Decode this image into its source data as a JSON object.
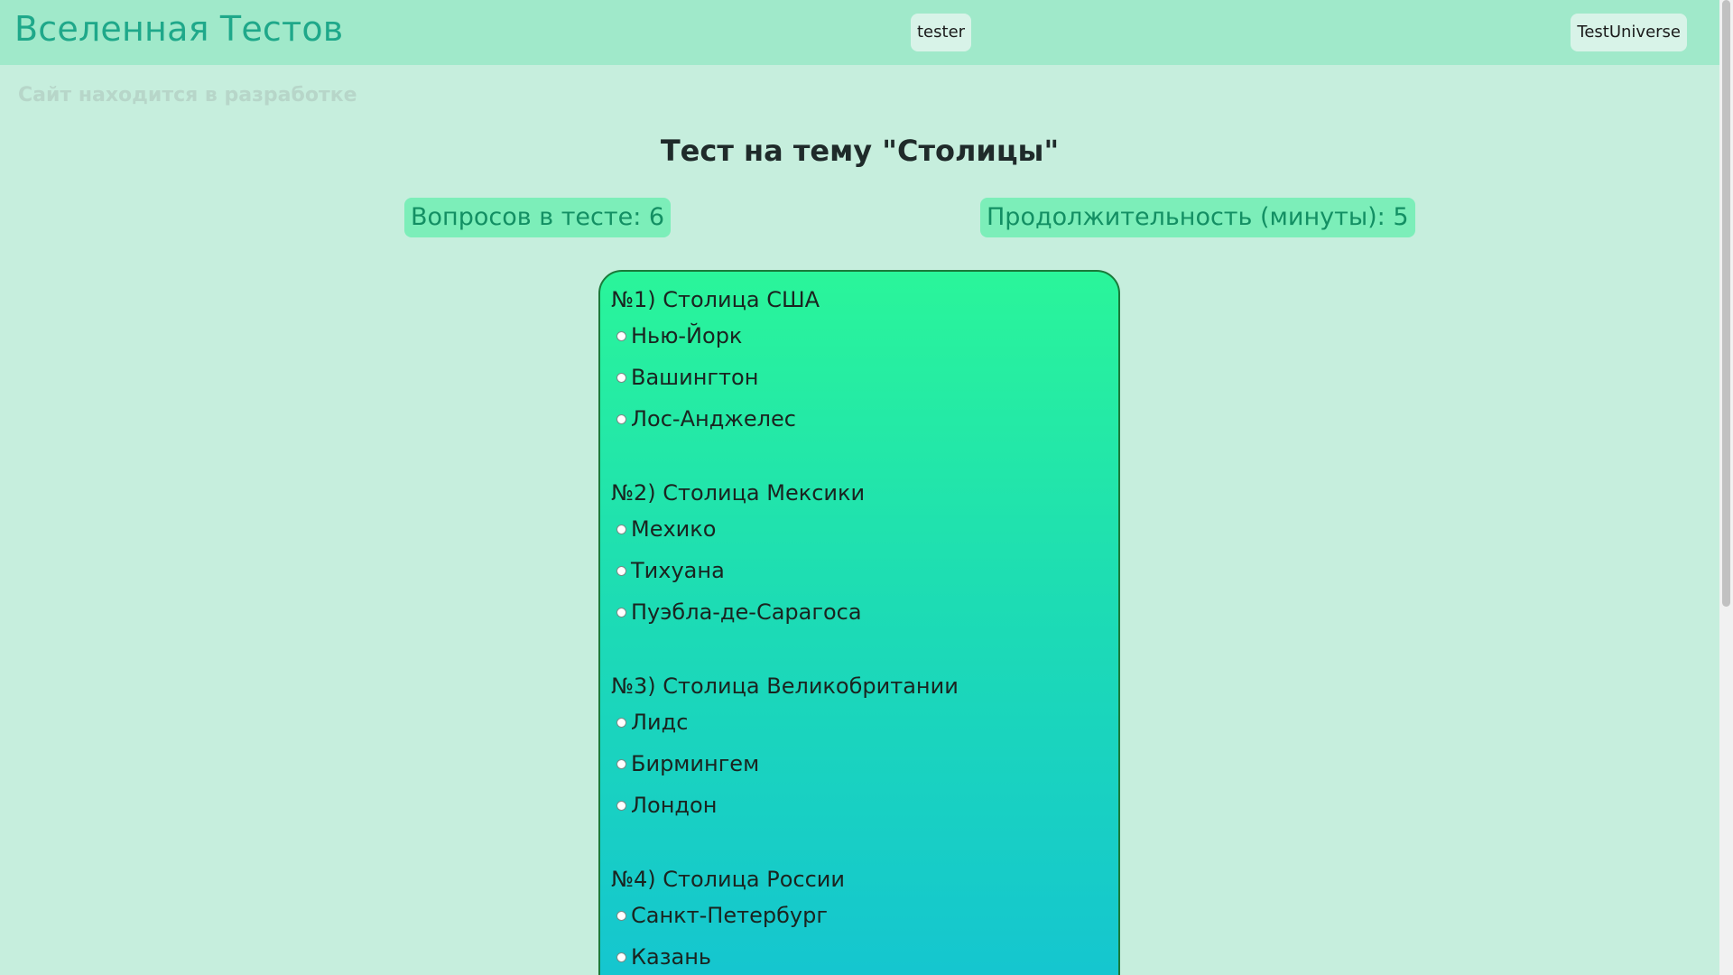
{
  "header": {
    "brand": "Вселенная Тестов",
    "user": "tester",
    "site": "TestUniverse"
  },
  "notice": "Сайт находится в разработке",
  "test": {
    "title": "Тест на тему \"Столицы\"",
    "questions_count": "Вопросов в тесте: 6",
    "duration": "Продолжительность (минуты): 5"
  },
  "questions": [
    {
      "text": "№1) Столица США",
      "options": [
        "Нью-Йорк",
        "Вашингтон",
        "Лос-Анджелес"
      ]
    },
    {
      "text": "№2) Столица Мексики",
      "options": [
        "Мехико",
        "Тихуана",
        "Пуэбла-де-Сарагоса"
      ]
    },
    {
      "text": "№3) Столица Великобритании",
      "options": [
        "Лидс",
        "Бирмингем",
        "Лондон"
      ]
    },
    {
      "text": "№4) Столица России",
      "options": [
        "Санкт-Петербург",
        "Казань"
      ]
    }
  ],
  "colors": {
    "background": "#c6eedd",
    "header": "#a0e9ca",
    "brand": "#1fa88a",
    "stat_bg": "#7ceeb9",
    "stat_text": "#138f63",
    "quiz_top": "#2af59a",
    "quiz_bottom": "#14c4d2"
  }
}
